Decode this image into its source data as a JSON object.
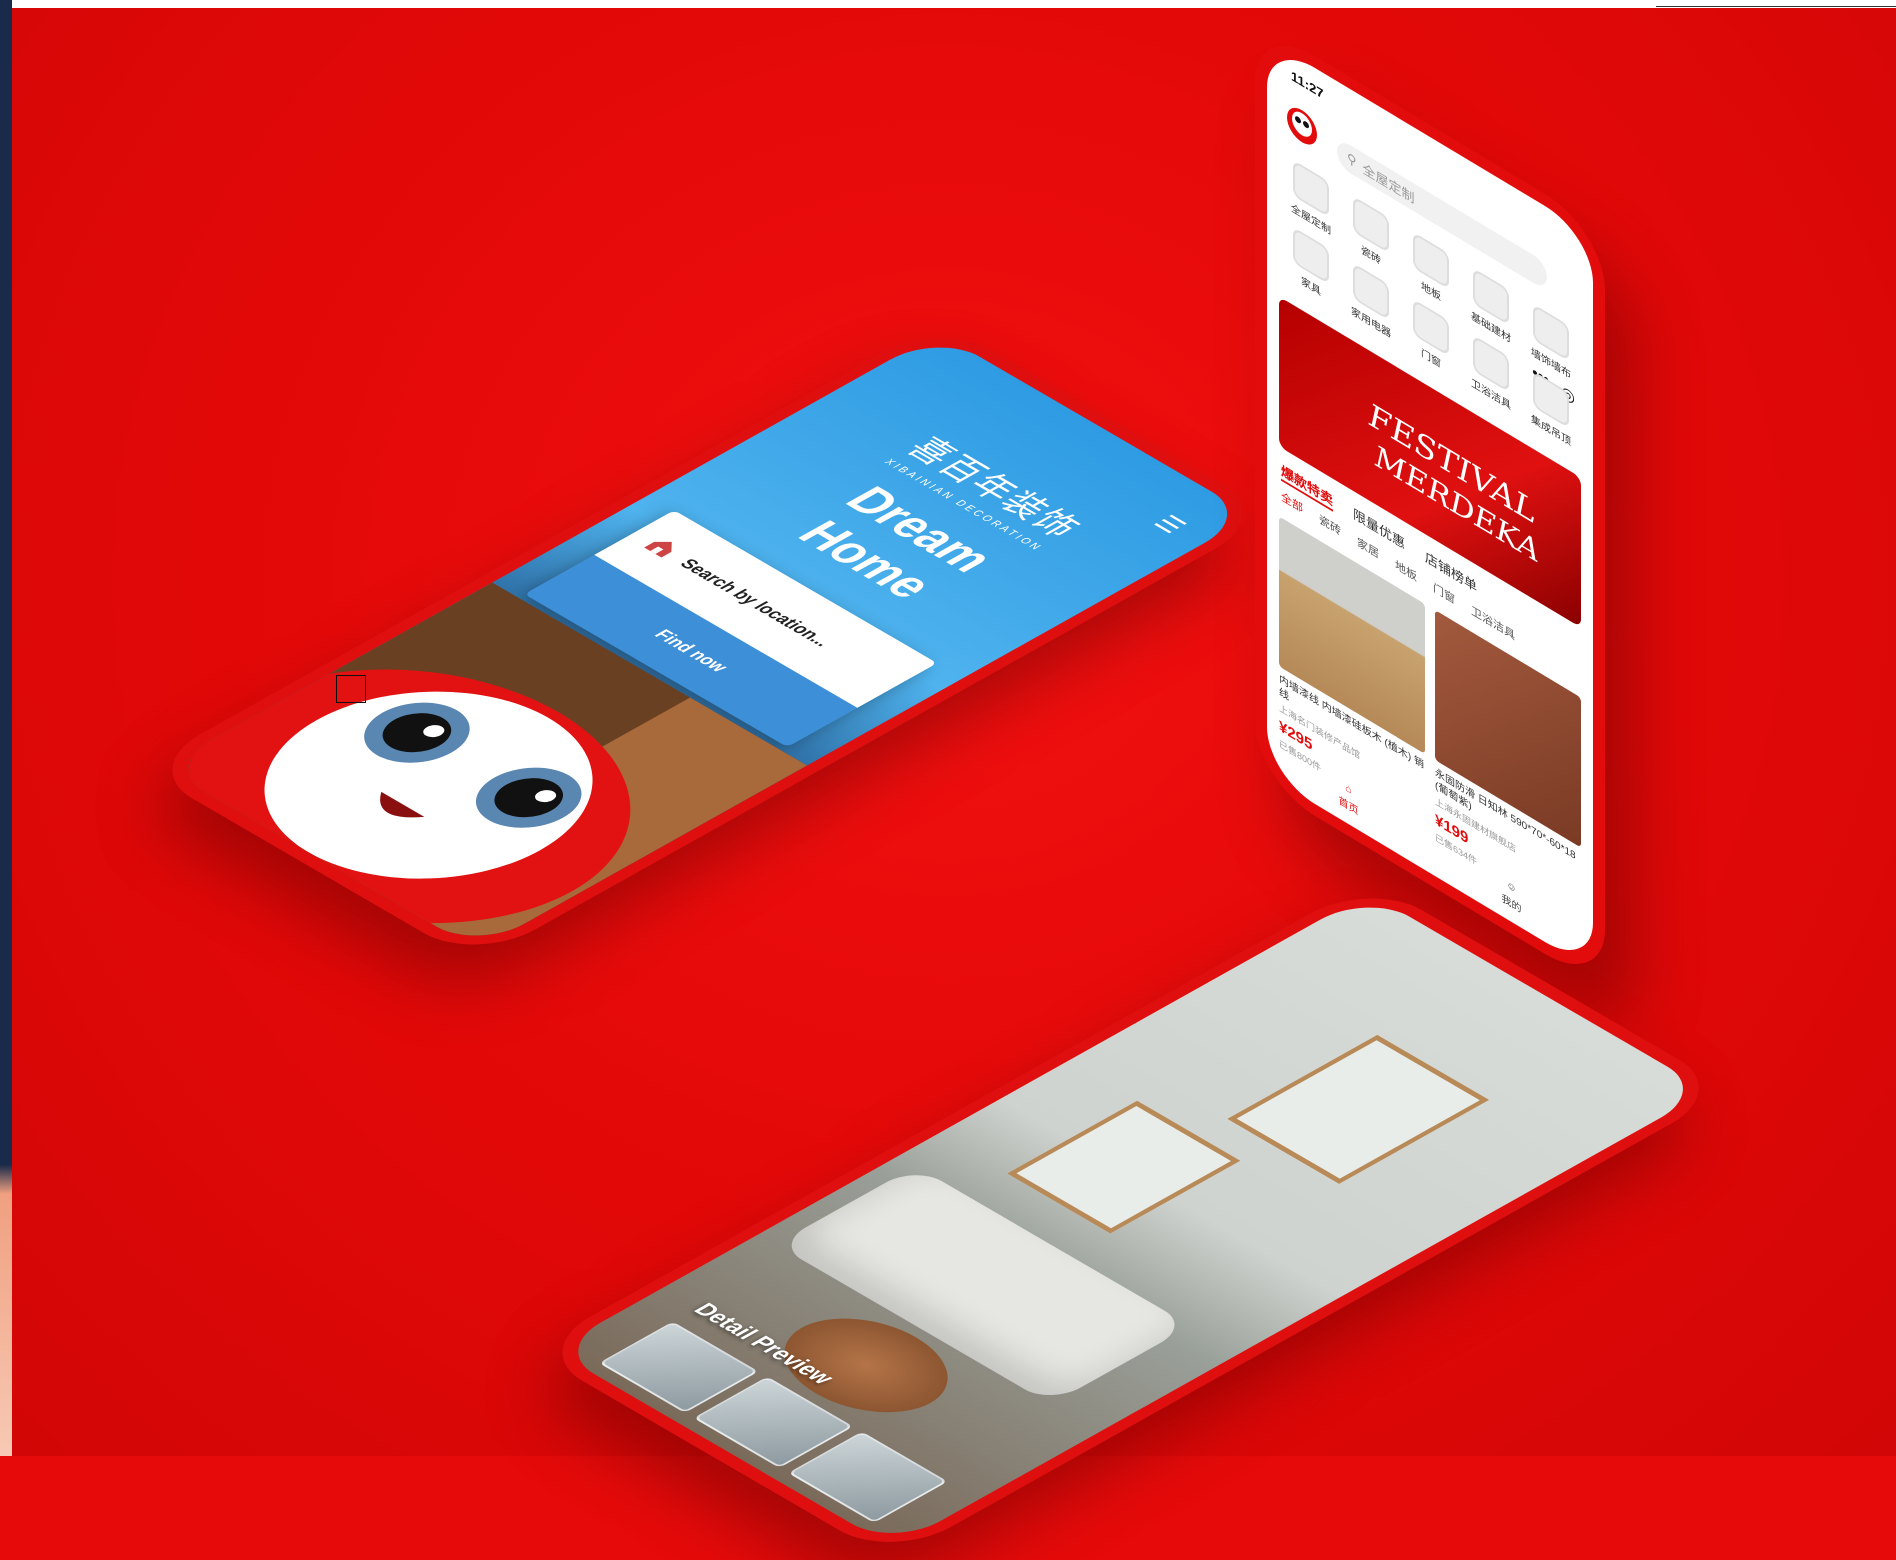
{
  "colors": {
    "background": "#e60a0a",
    "phone_red": "#e00f0f",
    "screen_blue": "#2e9be3",
    "button_blue": "#3d8fd8",
    "accent_red": "#e20c0c"
  },
  "phone_home": {
    "brand_cn": "喜百年装饰",
    "brand_sub": "XIBAINIAN DECORATION",
    "title": "Dream Home",
    "menu_icon": "menu-icon",
    "search_placeholder": "Search by location...",
    "find_button": "Find now"
  },
  "phone_shop": {
    "status_time": "11:27",
    "search_placeholder": "全屋定制",
    "categories": [
      {
        "label": "全屋定制",
        "icon": "cabinet-icon"
      },
      {
        "label": "瓷砖",
        "icon": "tile-icon"
      },
      {
        "label": "地板",
        "icon": "floor-icon"
      },
      {
        "label": "基础建材",
        "icon": "material-icon"
      },
      {
        "label": "墙饰墙布",
        "icon": "wall-icon"
      },
      {
        "label": "家具",
        "icon": "furniture-icon"
      },
      {
        "label": "家用电器",
        "icon": "appliance-icon"
      },
      {
        "label": "门窗",
        "icon": "window-icon"
      },
      {
        "label": "卫浴洁具",
        "icon": "bath-icon"
      },
      {
        "label": "集成吊顶",
        "icon": "ceiling-icon"
      }
    ],
    "banner_line1": "FESTIVAL",
    "banner_line2": "MERDEKA",
    "tabs": [
      "爆款特卖",
      "限量优惠",
      "店铺榜单"
    ],
    "chips": [
      "全部",
      "瓷砖",
      "家居",
      "地板",
      "门窗",
      "卫浴洁具"
    ],
    "products": [
      {
        "name": "内墙漆线 内墙漆硅板木 (植木) 销线",
        "shop": "上海名门装修产品馆",
        "price": "¥295",
        "sales": "已售800件"
      },
      {
        "name": "永固防滑 日知林 590*70*-60*18 (葡萄紫)",
        "shop": "上海永固建材旗舰店",
        "price": "¥199",
        "sales": "已售634件"
      }
    ],
    "nav": [
      {
        "label": "首页",
        "icon": "home-icon"
      },
      {
        "label": "我的",
        "icon": "user-icon"
      }
    ]
  },
  "phone_preview": {
    "label": "Detail Preview"
  }
}
